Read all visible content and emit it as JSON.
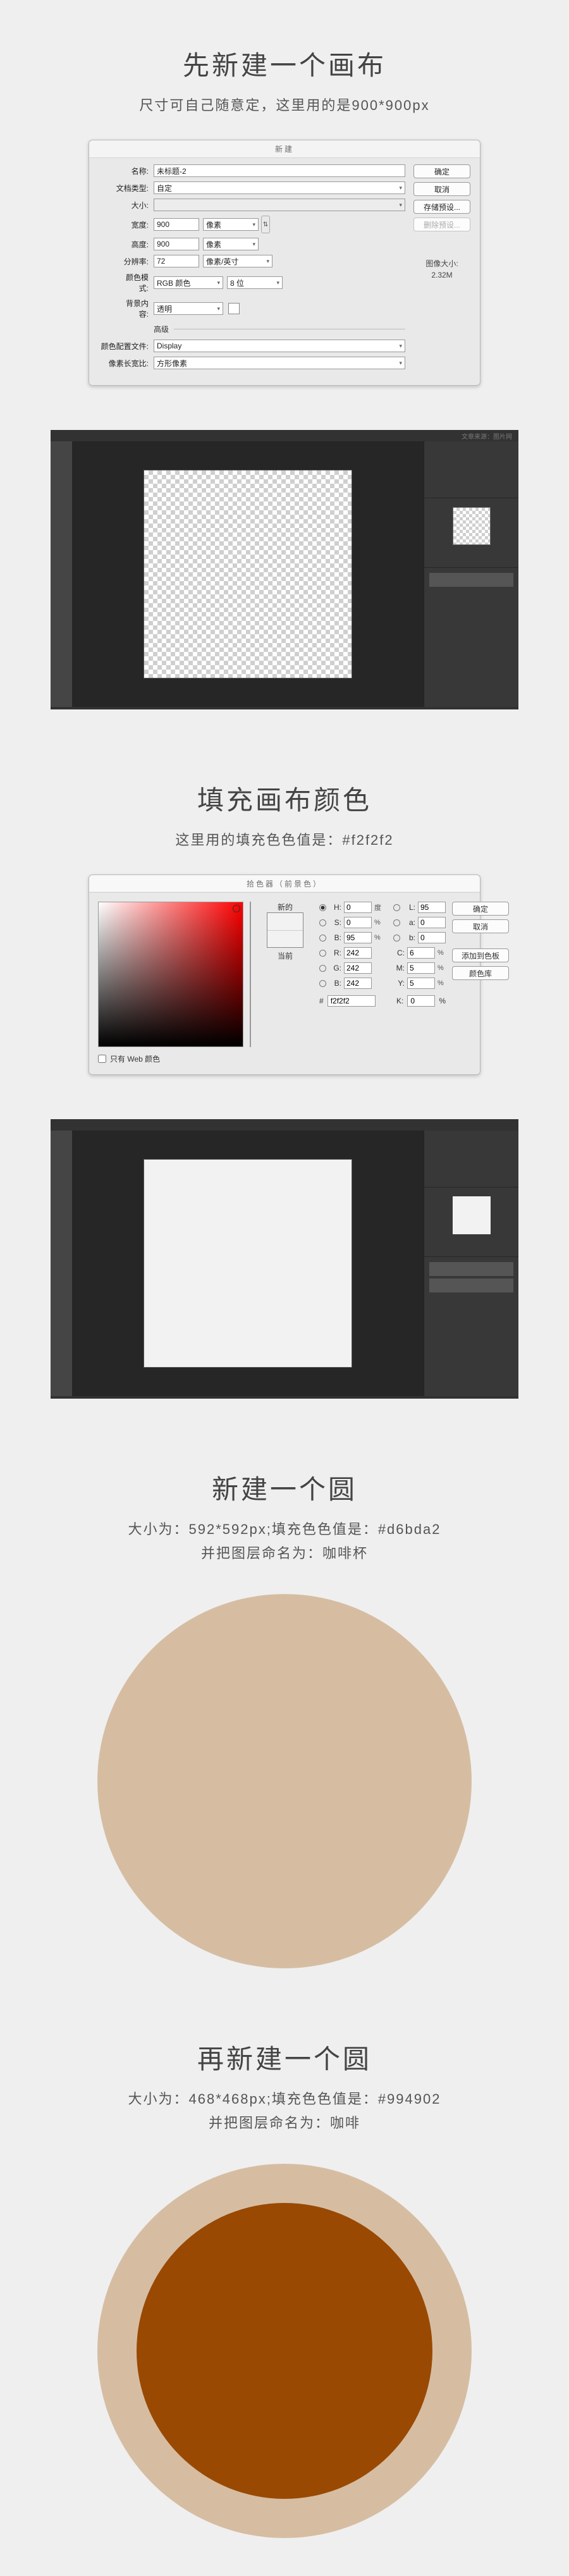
{
  "sections": {
    "s1": {
      "title": "先新建一个画布",
      "sub": "尺寸可自己随意定，这里用的是900*900px"
    },
    "s2": {
      "title": "填充画布颜色",
      "sub": "这里用的填充色色值是：#f2f2f2"
    },
    "s3": {
      "title": "新建一个圆",
      "sub1": "大小为：592*592px;填充色色值是：#d6bda2",
      "sub2": "并把图层命名为：咖啡杯"
    },
    "s4": {
      "title": "再新建一个圆",
      "sub1": "大小为：468*468px;填充色色值是：#994902",
      "sub2": "并把图层命名为：咖啡"
    }
  },
  "new_dialog": {
    "title": "新建",
    "labels": {
      "name": "名称:",
      "preset": "文档类型:",
      "size": "大小:",
      "width": "宽度:",
      "height": "高度:",
      "res": "分辨率:",
      "mode": "颜色模式:",
      "bg": "背景内容:",
      "adv": "高级",
      "profile": "颜色配置文件:",
      "ratio": "像素长宽比:"
    },
    "values": {
      "name": "未标题-2",
      "preset": "自定",
      "width": "900",
      "width_unit": "像素",
      "height": "900",
      "height_unit": "像素",
      "res": "72",
      "res_unit": "像素/英寸",
      "mode": "RGB 颜色",
      "depth": "8 位",
      "bg": "透明",
      "profile": "Display",
      "ratio": "方形像素"
    },
    "buttons": {
      "ok": "确定",
      "cancel": "取消",
      "save": "存储预设...",
      "delete": "删除预设..."
    },
    "image_size": {
      "label": "图像大小:",
      "value": "2.32M"
    }
  },
  "color_picker": {
    "title": "拾色器（前景色）",
    "web_only": "只有 Web 颜色",
    "new": "新的",
    "current": "当前",
    "h": "H:",
    "s": "S:",
    "b": "B:",
    "r": "R:",
    "g": "G:",
    "bb": "B:",
    "l": "L:",
    "a": "a:",
    "bb2": "b:",
    "c": "C:",
    "m": "M:",
    "y": "Y:",
    "k": "K:",
    "vals": {
      "h": "0",
      "s": "0",
      "b": "95",
      "r": "242",
      "g": "242",
      "bb": "242",
      "l": "95",
      "a": "0",
      "bb2": "0",
      "c": "6",
      "m": "5",
      "y": "5",
      "k": "0"
    },
    "pct": "%",
    "deg": "度",
    "hex_label": "#",
    "hex": "f2f2f2",
    "buttons": {
      "ok": "确定",
      "cancel": "取消",
      "add": "添加到色板",
      "lib": "颜色库"
    }
  },
  "watermark": "文章来源：图片网"
}
